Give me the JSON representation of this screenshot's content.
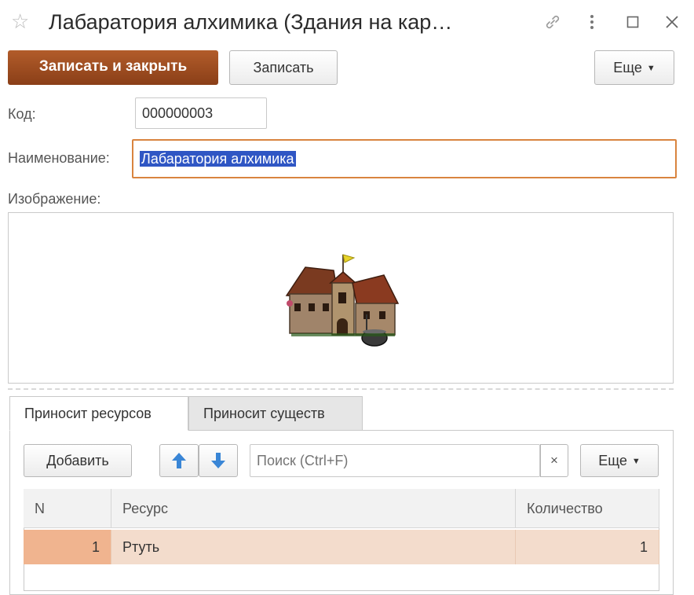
{
  "window": {
    "title": "Лабаратория алхимика (Здания на кар…"
  },
  "toolbar": {
    "save_close_label": "Записать и закрыть",
    "save_label": "Записать",
    "more_label": "Еще"
  },
  "form": {
    "code_label": "Код:",
    "code_value": "000000003",
    "name_label": "Наименование:",
    "name_value": "Лабаратория алхимика",
    "image_label": "Изображение:"
  },
  "tabs": [
    {
      "label": "Приносит ресурсов",
      "active": true
    },
    {
      "label": "Приносит существ",
      "active": false
    }
  ],
  "subtoolbar": {
    "add_label": "Добавить",
    "search_placeholder": "Поиск (Ctrl+F)",
    "clear_symbol": "×",
    "more_label": "Еще"
  },
  "table": {
    "columns": [
      "N",
      "Ресурс",
      "Количество"
    ],
    "rows": [
      {
        "n": "1",
        "resource": "Ртуть",
        "quantity": "1"
      }
    ]
  },
  "icons": {
    "favorite": "star-icon",
    "link": "link-icon",
    "menu": "more-vertical-icon",
    "maximize": "maximize-icon",
    "close": "close-icon",
    "move_up": "arrow-up-icon",
    "move_down": "arrow-down-icon"
  },
  "colors": {
    "primary_button": "#9c4a1f",
    "focus_border": "#d9843f",
    "selection": "#2f56c4",
    "row_selected": "#f3dccc",
    "arrow": "#3a86d6"
  }
}
